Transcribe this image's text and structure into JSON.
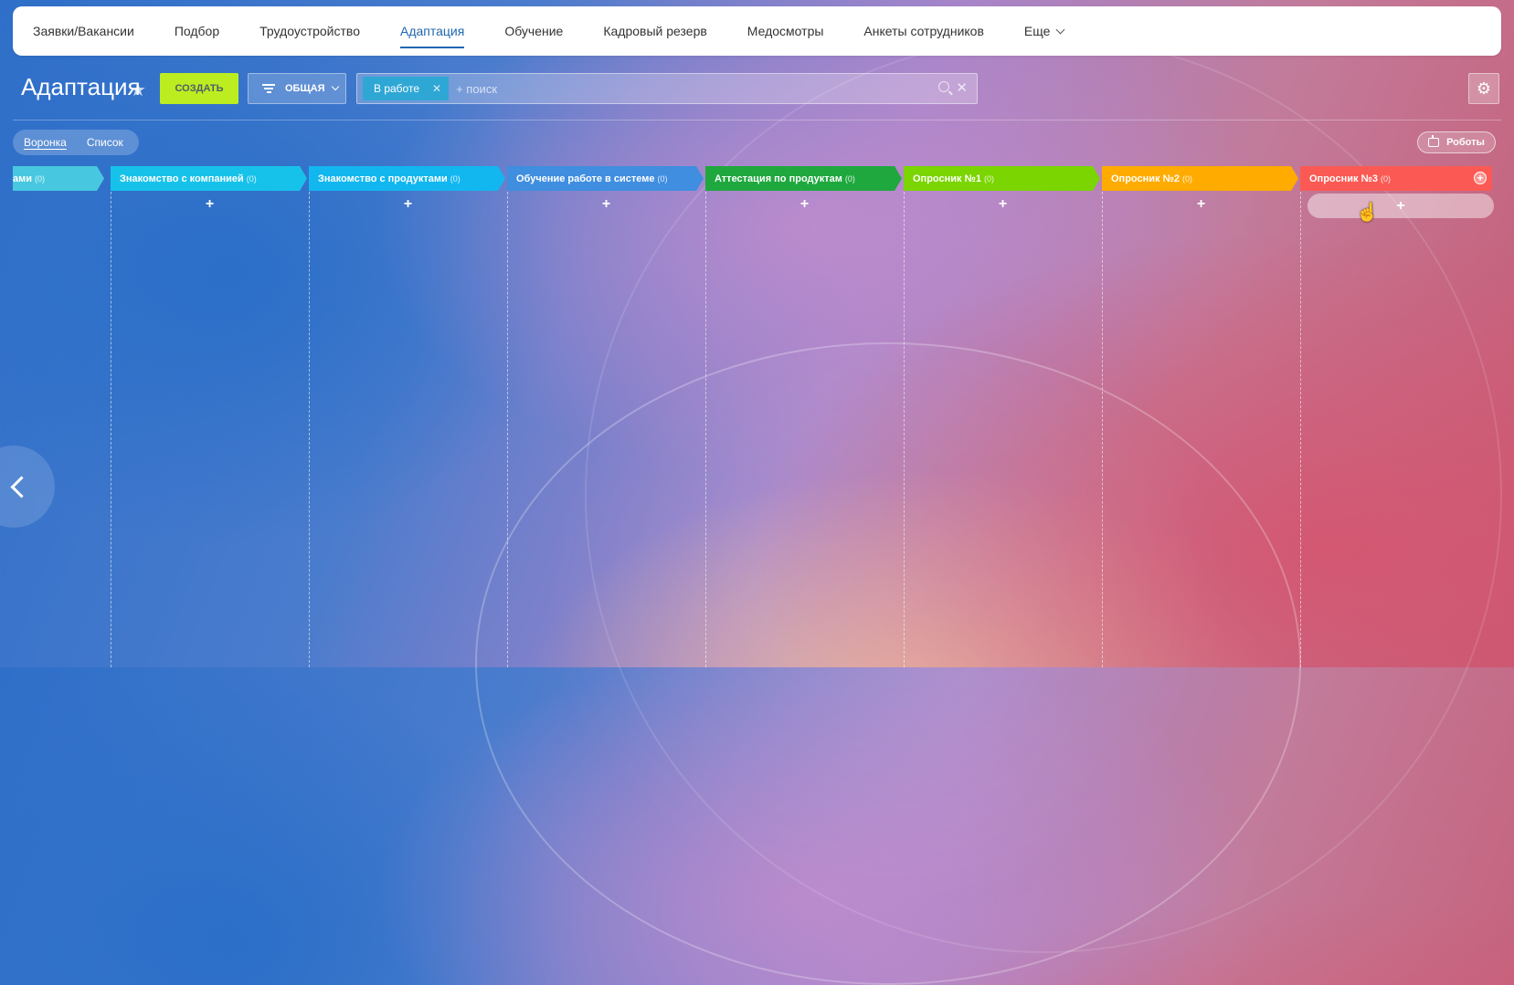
{
  "topnav": {
    "items": [
      {
        "label": "Заявки/Вакансии",
        "active": false
      },
      {
        "label": "Подбор",
        "active": false
      },
      {
        "label": "Трудоустройство",
        "active": false
      },
      {
        "label": "Адаптация",
        "active": true
      },
      {
        "label": "Обучение",
        "active": false
      },
      {
        "label": "Кадровый резерв",
        "active": false
      },
      {
        "label": "Медосмотры",
        "active": false
      },
      {
        "label": "Анкеты сотрудников",
        "active": false
      },
      {
        "label": "Еще",
        "active": false
      }
    ]
  },
  "toolbar": {
    "title": "Адаптация",
    "create_label": "СОЗДАТЬ",
    "filter_label": "ОБЩАЯ",
    "filter_tag": "В работе",
    "search_placeholder": "+ поиск"
  },
  "view_switch": {
    "tabs": [
      {
        "label": "Воронка",
        "active": true
      },
      {
        "label": "Список",
        "active": false
      }
    ],
    "robots_label": "Роботы"
  },
  "kanban": {
    "columns": [
      {
        "title": "ами",
        "count": "(0)",
        "color": "#47c8e0"
      },
      {
        "title": "Знакомство с компанией",
        "count": "(0)",
        "color": "#17c2ea"
      },
      {
        "title": "Знакомство с продуктами",
        "count": "(0)",
        "color": "#12b7f0"
      },
      {
        "title": "Обучение работе в системе",
        "count": "(0)",
        "color": "#3f8ee0"
      },
      {
        "title": "Аттестация по продуктам",
        "count": "(0)",
        "color": "#1fa83e"
      },
      {
        "title": "Опросник №1",
        "count": "(0)",
        "color": "#7ad500"
      },
      {
        "title": "Опросник №2",
        "count": "(0)",
        "color": "#ffab00"
      },
      {
        "title": "Опросник №3",
        "count": "(0)",
        "color": "#fa5a53"
      }
    ],
    "add_symbol": "+"
  },
  "colors": {
    "accent": "#2067b0",
    "create_button": "#bbed21",
    "filter_tag": "#2fa7d5"
  },
  "icons": [
    "star-icon",
    "filter-icon",
    "search-icon",
    "close-icon",
    "gear-icon",
    "robot-icon",
    "chevron-left-icon",
    "plus-icon",
    "hand-cursor-icon"
  ]
}
